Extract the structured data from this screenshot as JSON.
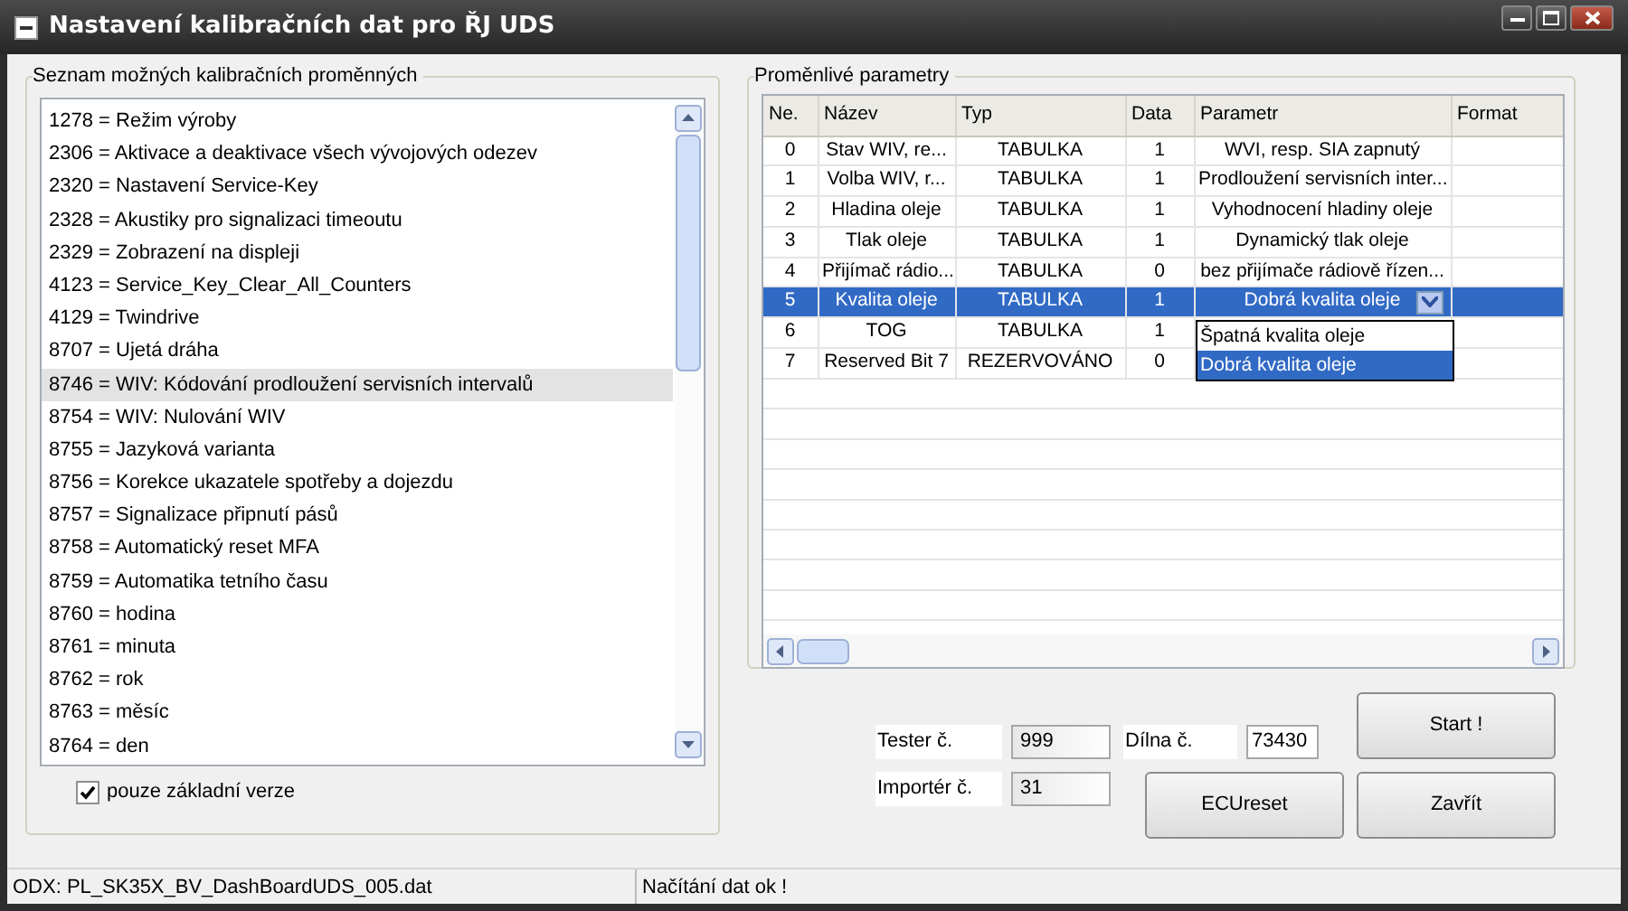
{
  "window": {
    "title": "Nastavení kalibračních dat pro ŘJ UDS"
  },
  "variables_group": {
    "title": "Seznam možných kalibračních proměnných",
    "items": [
      {
        "text": "1278 = Režim výroby",
        "selected": false
      },
      {
        "text": "2306 = Aktivace a deaktivace všech vývojových odezev",
        "selected": false
      },
      {
        "text": "2320 = Nastavení Service-Key",
        "selected": false
      },
      {
        "text": "2328 = Akustiky pro signalizaci timeoutu",
        "selected": false
      },
      {
        "text": "2329 = Zobrazení na displeji",
        "selected": false
      },
      {
        "text": "4123 = Service_Key_Clear_All_Counters",
        "selected": false
      },
      {
        "text": "4129 = Twindrive",
        "selected": false
      },
      {
        "text": "8707 = Ujetá dráha",
        "selected": false
      },
      {
        "text": "8746 = WIV: Kódování prodloužení servisních intervalů",
        "selected": true
      },
      {
        "text": "8754 = WIV: Nulování WIV",
        "selected": false
      },
      {
        "text": "8755 = Jazyková varianta",
        "selected": false
      },
      {
        "text": "8756 = Korekce ukazatele spotřeby a dojezdu",
        "selected": false
      },
      {
        "text": "8757 = Signalizace připnutí pásů",
        "selected": false
      },
      {
        "text": "8758 = Automatický reset MFA",
        "selected": false
      },
      {
        "text": "8759 = Automatika tetního času",
        "selected": false
      },
      {
        "text": "8760 = hodina",
        "selected": false
      },
      {
        "text": "8761 = minuta",
        "selected": false
      },
      {
        "text": "8762 = rok",
        "selected": false
      },
      {
        "text": "8763 = měsíc",
        "selected": false
      },
      {
        "text": "8764 = den",
        "selected": false
      }
    ],
    "checkbox": {
      "label": "pouze základní verze",
      "checked": true
    }
  },
  "parameters_group": {
    "title": "Proměnlivé parametry",
    "columns": [
      "Ne.",
      "Název",
      "Typ",
      "Data",
      "Parametr",
      "Format"
    ],
    "rows": [
      {
        "cells": [
          "0",
          "Stav WIV, re...",
          "TABULKA",
          "1",
          "WVI, resp. SIA zapnutý"
        ],
        "selected": false
      },
      {
        "cells": [
          "1",
          "Volba WIV, r...",
          "TABULKA",
          "1",
          "Prodloužení servisních inter..."
        ],
        "selected": false
      },
      {
        "cells": [
          "2",
          "Hladina oleje",
          "TABULKA",
          "1",
          "Vyhodnocení hladiny oleje"
        ],
        "selected": false
      },
      {
        "cells": [
          "3",
          "Tlak oleje",
          "TABULKA",
          "1",
          "Dynamický tlak oleje"
        ],
        "selected": false
      },
      {
        "cells": [
          "4",
          "Přijímač rádio...",
          "TABULKA",
          "0",
          "bez přijímače rádiově řízen..."
        ],
        "selected": false
      },
      {
        "cells": [
          "5",
          "Kvalita oleje",
          "TABULKA",
          "1",
          "Dobrá kvalita oleje"
        ],
        "selected": true,
        "dropdown_options": [
          {
            "label": "Špatná kvalita oleje",
            "selected": false
          },
          {
            "label": "Dobrá kvalita oleje",
            "selected": true
          }
        ]
      },
      {
        "cells": [
          "6",
          "TOG",
          "TABULKA",
          "1",
          ""
        ],
        "selected": false
      },
      {
        "cells": [
          "7",
          "Reserved Bit 7",
          "REZERVOVÁNO",
          "0",
          ""
        ],
        "selected": false
      }
    ]
  },
  "fields": [
    {
      "label": "Tester č.",
      "value": "999"
    },
    {
      "label": "Dílna č.",
      "value": "73430"
    },
    {
      "label": "Importér č.",
      "value": "31"
    }
  ],
  "buttons": [
    "Start !",
    "ECUreset",
    "Zavřít"
  ],
  "status_bar": [
    "ODX: PL_SK35X_BV_DashBoardUDS_005.dat",
    "Načítání dat ok !"
  ]
}
